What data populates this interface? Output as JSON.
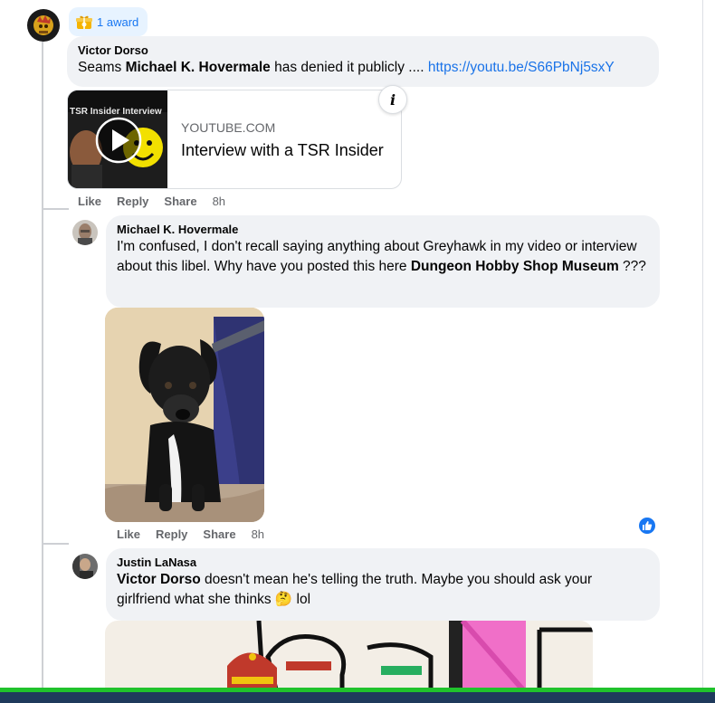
{
  "award": {
    "label": "1 award",
    "icon": "gift-icon"
  },
  "comments": [
    {
      "author": "Victor Dorso",
      "text_before": "Seams ",
      "mention": "Michael K. Hovermale",
      "text_after": " has denied it publicly .... ",
      "link": "https://youtu.be/S66PbNj5sxY",
      "link_preview": {
        "thumb_caption": "TSR Insider Interview",
        "domain": "YOUTUBE.COM",
        "title": "Interview with a TSR Insider"
      },
      "actions": {
        "like": "Like",
        "reply": "Reply",
        "share": "Share",
        "time": "8h"
      }
    },
    {
      "author": "Michael K. Hovermale",
      "text_before": "I'm confused, I don't recall saying anything about Greyhawk in my video or interview about this libel. Why have you posted this here ",
      "mention": "Dungeon Hobby Shop Museum",
      "text_after": " ???",
      "actions": {
        "like": "Like",
        "reply": "Reply",
        "share": "Share",
        "time": "8h"
      }
    },
    {
      "author": "Justin LaNasa",
      "mention": "Victor Dorso",
      "text_after": " doesn't mean he's telling the truth. Maybe you should ask your girlfriend what she thinks ",
      "emoji": "🤔",
      "text_end": " lol"
    }
  ],
  "colors": {
    "link": "#1a73e8",
    "bubble": "#f0f2f5",
    "accent": "#1877f2",
    "meta": "#65676b"
  }
}
